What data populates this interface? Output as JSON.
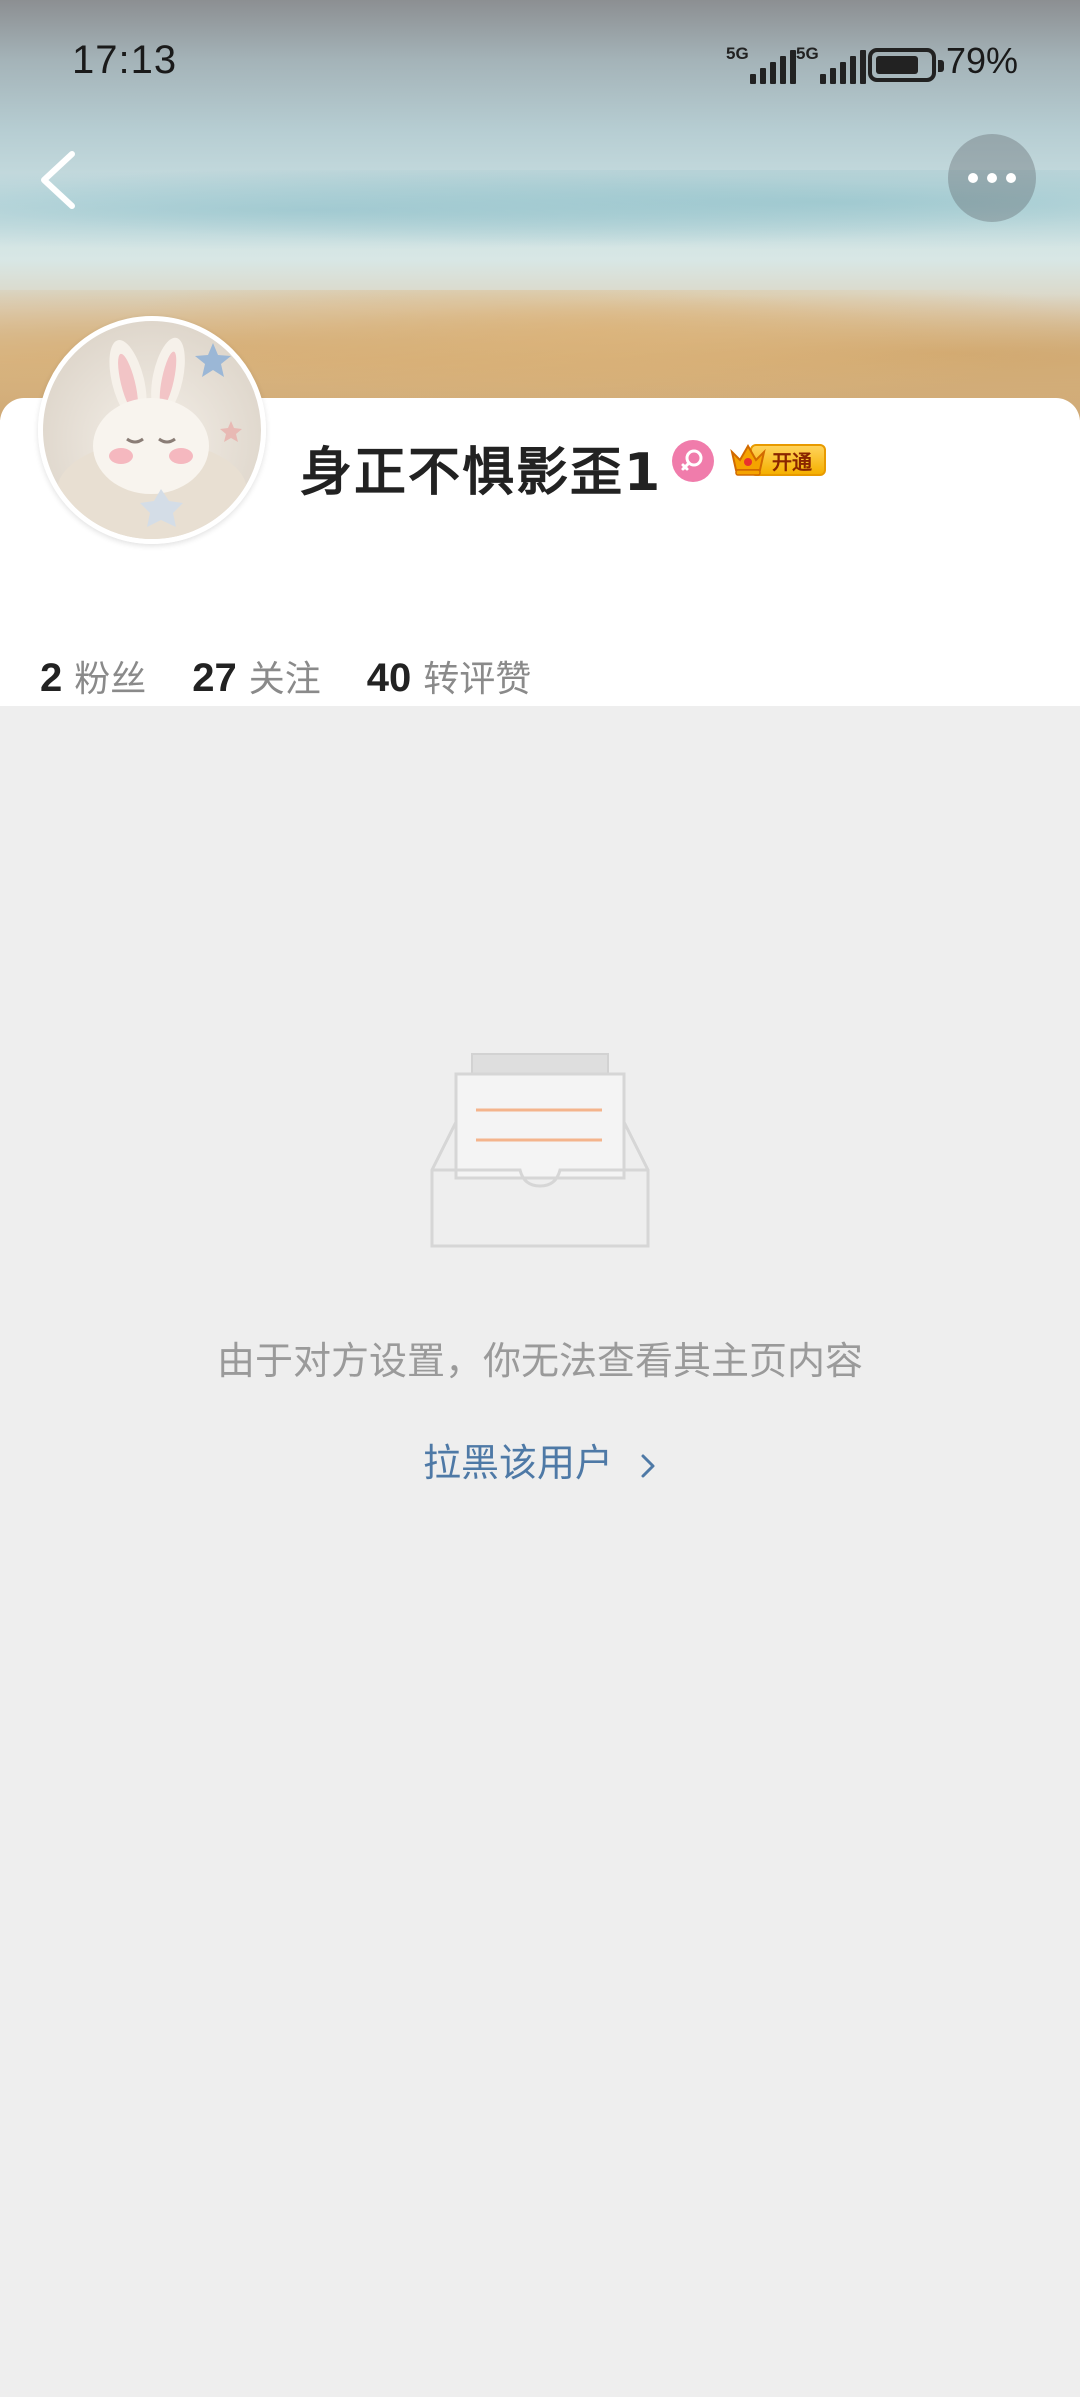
{
  "status_bar": {
    "time": "17:13",
    "network1": "5G",
    "network2": "5G",
    "battery_percent": "79%",
    "battery_level": 0.79
  },
  "nav": {
    "back_icon": "chevron-left-icon",
    "more_icon": "more-dots-icon"
  },
  "profile": {
    "username": "身正不惧影歪1",
    "gender_icon": "female-icon",
    "gender_color": "#f07cab",
    "vip_label": "开通",
    "vip_icon": "crown-icon"
  },
  "stats": [
    {
      "value": "2",
      "label": "粉丝"
    },
    {
      "value": "27",
      "label": "关注"
    },
    {
      "value": "40",
      "label": "转评赞"
    }
  ],
  "empty_state": {
    "icon": "empty-inbox-icon",
    "message": "由于对方设置，你无法查看其主页内容",
    "action_label": "拉黑该用户",
    "action_color": "#4e79a6"
  }
}
